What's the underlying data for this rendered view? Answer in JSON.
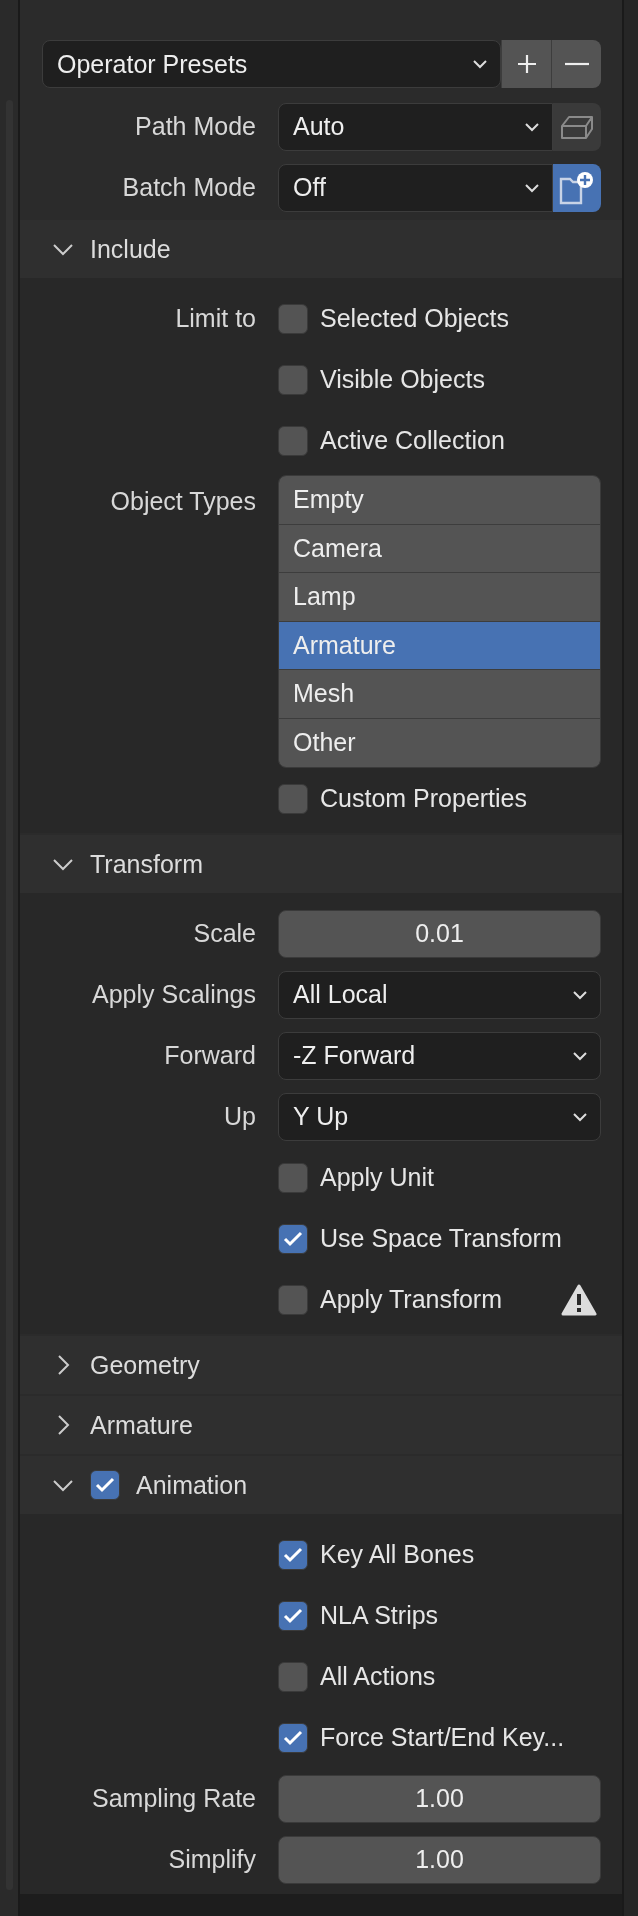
{
  "presets": {
    "value": "Operator Presets"
  },
  "top_fields": [
    {
      "label": "Path Mode",
      "value": "Auto",
      "toggle": {
        "kind": "box",
        "selected": false
      }
    },
    {
      "label": "Batch Mode",
      "value": "Off",
      "toggle": {
        "kind": "folder",
        "selected": true
      }
    }
  ],
  "sections": [
    {
      "title": "Include",
      "expanded": true,
      "rows": [
        {
          "kind": "checkbox",
          "label": "Limit to",
          "text": "Selected Objects",
          "checked": false
        },
        {
          "kind": "checkbox",
          "text": "Visible Objects",
          "checked": false
        },
        {
          "kind": "checkbox",
          "text": "Active Collection",
          "checked": false
        },
        {
          "kind": "list",
          "label": "Object Types",
          "items": [
            {
              "text": "Empty",
              "selected": false
            },
            {
              "text": "Camera",
              "selected": false
            },
            {
              "text": "Lamp",
              "selected": false
            },
            {
              "text": "Armature",
              "selected": true
            },
            {
              "text": "Mesh",
              "selected": false
            },
            {
              "text": "Other",
              "selected": false
            }
          ]
        },
        {
          "kind": "checkbox",
          "text": "Custom Properties",
          "checked": false
        }
      ]
    },
    {
      "title": "Transform",
      "expanded": true,
      "rows": [
        {
          "kind": "number",
          "label": "Scale",
          "value": "0.01"
        },
        {
          "kind": "dropdown",
          "label": "Apply Scalings",
          "value": "All Local"
        },
        {
          "kind": "dropdown",
          "label": "Forward",
          "value": "-Z Forward"
        },
        {
          "kind": "dropdown",
          "label": "Up",
          "value": "Y Up"
        },
        {
          "kind": "checkbox",
          "text": "Apply Unit",
          "checked": false
        },
        {
          "kind": "checkbox",
          "text": "Use Space Transform",
          "checked": true
        },
        {
          "kind": "checkbox",
          "text": "Apply Transform",
          "checked": false,
          "warning": true
        }
      ]
    },
    {
      "title": "Geometry",
      "expanded": false
    },
    {
      "title": "Armature",
      "expanded": false
    },
    {
      "title": "Animation",
      "expanded": true,
      "checkbox": {
        "checked": true
      },
      "rows": [
        {
          "kind": "checkbox",
          "text": "Key All Bones",
          "checked": true
        },
        {
          "kind": "checkbox",
          "text": "NLA Strips",
          "checked": true
        },
        {
          "kind": "checkbox",
          "text": "All Actions",
          "checked": false
        },
        {
          "kind": "checkbox",
          "text": "Force Start/End Key...",
          "checked": true
        },
        {
          "kind": "number",
          "label": "Sampling Rate",
          "value": "1.00"
        },
        {
          "kind": "number",
          "label": "Simplify",
          "value": "1.00"
        }
      ]
    }
  ]
}
